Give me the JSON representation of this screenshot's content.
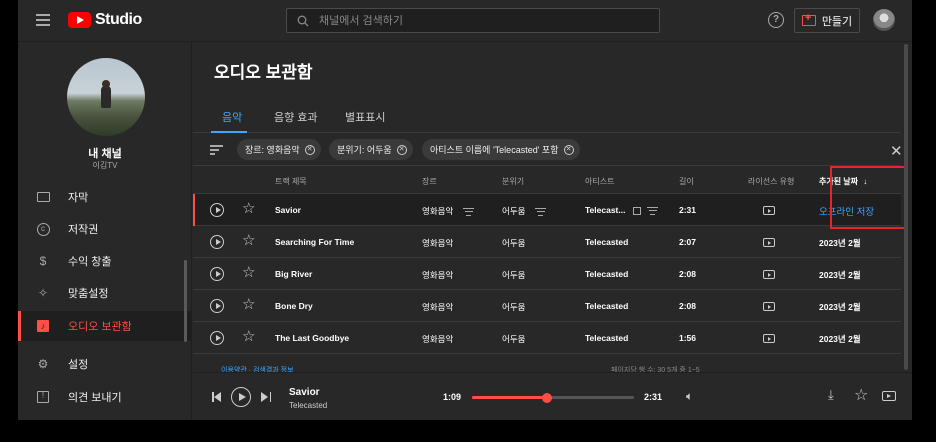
{
  "header": {
    "logo_text": "Studio",
    "search_placeholder": "채널에서 검색하기",
    "help_label": "?",
    "create_label": "만들기"
  },
  "sidebar": {
    "channel_name": "내 채널",
    "channel_handle": "이김TV",
    "items": [
      {
        "label": "자막",
        "icon": "subtitles-icon"
      },
      {
        "label": "저작권",
        "icon": "copyright-icon"
      },
      {
        "label": "수익 창출",
        "icon": "dollar-icon"
      },
      {
        "label": "맞춤설정",
        "icon": "magic-wand-icon"
      },
      {
        "label": "오디오 보관함",
        "icon": "audio-library-icon",
        "active": true
      },
      {
        "label": "설정",
        "icon": "gear-icon"
      },
      {
        "label": "의견 보내기",
        "icon": "feedback-icon"
      }
    ]
  },
  "page": {
    "title": "오디오 보관함",
    "tabs": [
      {
        "label": "음악",
        "active": true
      },
      {
        "label": "음향 효과"
      },
      {
        "label": "별표표시"
      }
    ],
    "filters": [
      {
        "label": "장르: 영화음악"
      },
      {
        "label": "분위기: 어두움"
      },
      {
        "label": "아티스트 이름에 'Telecasted' 포함"
      }
    ]
  },
  "table": {
    "columns": [
      "트랙 제목",
      "장르",
      "분위기",
      "아티스트",
      "길이",
      "라이선스 유형",
      "추가된 날짜"
    ],
    "sort_arrow": "↓",
    "rows": [
      {
        "title": "Savior",
        "genre": "영화음악",
        "mood": "어두움",
        "artist": "Telecast...",
        "length": "2:31",
        "added": "오프라인 저장",
        "current": true
      },
      {
        "title": "Searching For Time",
        "genre": "영화음악",
        "mood": "어두움",
        "artist": "Telecasted",
        "length": "2:07",
        "added": "2023년 2월"
      },
      {
        "title": "Big River",
        "genre": "영화음악",
        "mood": "어두움",
        "artist": "Telecasted",
        "length": "2:08",
        "added": "2023년 2월"
      },
      {
        "title": "Bone Dry",
        "genre": "영화음악",
        "mood": "어두움",
        "artist": "Telecasted",
        "length": "2:08",
        "added": "2023년 2월"
      },
      {
        "title": "The Last Goodbye",
        "genre": "영화음악",
        "mood": "어두움",
        "artist": "Telecasted",
        "length": "1:56",
        "added": "2023년 2월"
      }
    ]
  },
  "pager": {
    "left": "이용약관 · 검색결과 정보",
    "right": "페이지당 행 수: 30   5개 중 1~5"
  },
  "player": {
    "title": "Savior",
    "artist": "Telecasted",
    "current_time": "1:09",
    "total_time": "2:31",
    "progress": 0.46
  },
  "colors": {
    "accent_red": "#ff4e45",
    "link_blue": "#3ea6ff",
    "highlight_box": "#e5252a",
    "background": "#282828"
  }
}
